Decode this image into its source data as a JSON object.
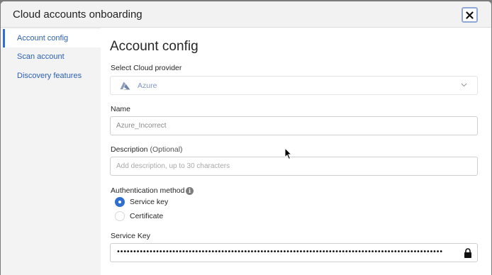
{
  "dialog": {
    "title": "Cloud accounts onboarding",
    "close_icon": "close-x-icon"
  },
  "sidebar": {
    "items": [
      {
        "label": "Account config",
        "active": true
      },
      {
        "label": "Scan account",
        "active": false
      },
      {
        "label": "Discovery features",
        "active": false
      }
    ]
  },
  "main": {
    "page_title": "Account config",
    "cloud_provider": {
      "label": "Select Cloud provider",
      "value": "Azure",
      "icon": "azure-logo-icon"
    },
    "name": {
      "label": "Name",
      "value": "Azure_Incorrect"
    },
    "description": {
      "label": "Description",
      "optional": "(Optional)",
      "placeholder": "Add description, up to 30 characters",
      "value": ""
    },
    "auth": {
      "label": "Authentication method",
      "info_icon": "info-icon",
      "options": [
        {
          "label": "Service key",
          "checked": true
        },
        {
          "label": "Certificate",
          "checked": false
        }
      ]
    },
    "service_key": {
      "label": "Service Key",
      "masked_value": "••••••••••••••••••••••••••••••••••••••••••••••••••••••••••••••••••••••••••••••••••••••••••••••••••••",
      "lock_icon": "lock-icon"
    }
  },
  "colors": {
    "accent": "#2f6fd0",
    "link": "#2b5fb4",
    "overlay": "#7b7b7b"
  }
}
